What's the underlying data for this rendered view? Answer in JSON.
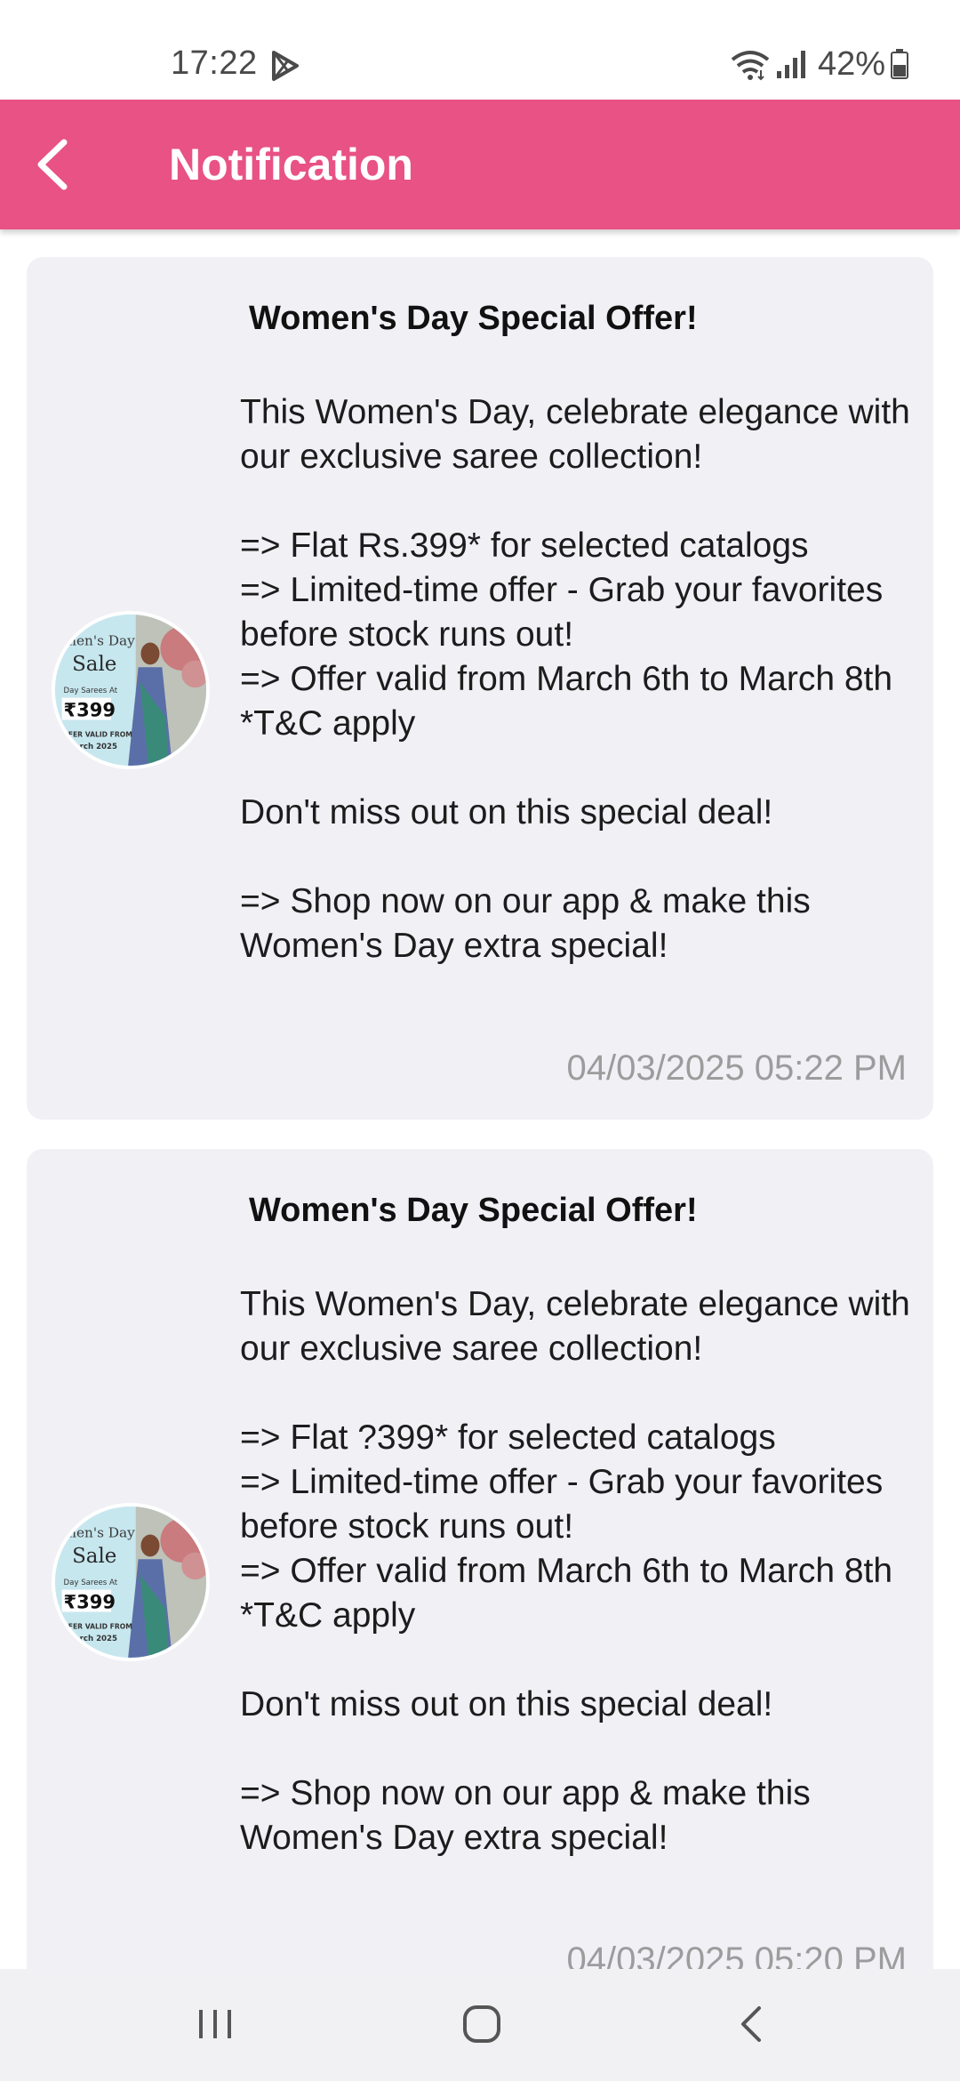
{
  "status_bar": {
    "time": "17:22",
    "battery": "42%"
  },
  "app_bar": {
    "title": "Notification",
    "color": "#e85284"
  },
  "notifications": [
    {
      "title": "Women's Day Special Offer!",
      "body": "This Women's Day, celebrate elegance with our exclusive saree collection!\n\n=> Flat Rs.399* for selected catalogs\n=> Limited-time offer - Grab your favorites before stock runs out!\n=> Offer valid from March 6th to March 8th\n*T&C apply\n\nDon't miss out on this special deal!\n\n=> Shop now on our app & make this Women's Day extra special!",
      "timestamp": "04/03/2025 05:22 PM",
      "thumb": {
        "line1": "men's Day",
        "line2": "Sale",
        "line3": "Day Sarees At",
        "price": "₹399",
        "line4": "FFER VALID FROM",
        "line5": "March 2025"
      }
    },
    {
      "title": "Women's Day Special Offer!",
      "body": "This Women's Day, celebrate elegance with our exclusive saree collection!\n\n=> Flat ?399* for selected catalogs\n=> Limited-time offer - Grab your favorites before stock runs out!\n=> Offer valid from March 6th to March 8th\n*T&C apply\n\nDon't miss out on this special deal!\n\n=> Shop now on our app & make this Women's Day extra special!",
      "timestamp": "04/03/2025 05:20 PM",
      "thumb": {
        "line1": "men's Day",
        "line2": "Sale",
        "line3": "Day Sarees At",
        "price": "₹399",
        "line4": "FFER VALID FROM",
        "line5": "March 2025"
      }
    }
  ],
  "icons": {
    "status_left": "play-store-icon",
    "status_right": [
      "wifi-icon",
      "signal-icon",
      "battery-icon"
    ],
    "app_bar": "back-arrow-icon",
    "nav": [
      "recent-apps-icon",
      "home-icon",
      "back-icon"
    ]
  }
}
